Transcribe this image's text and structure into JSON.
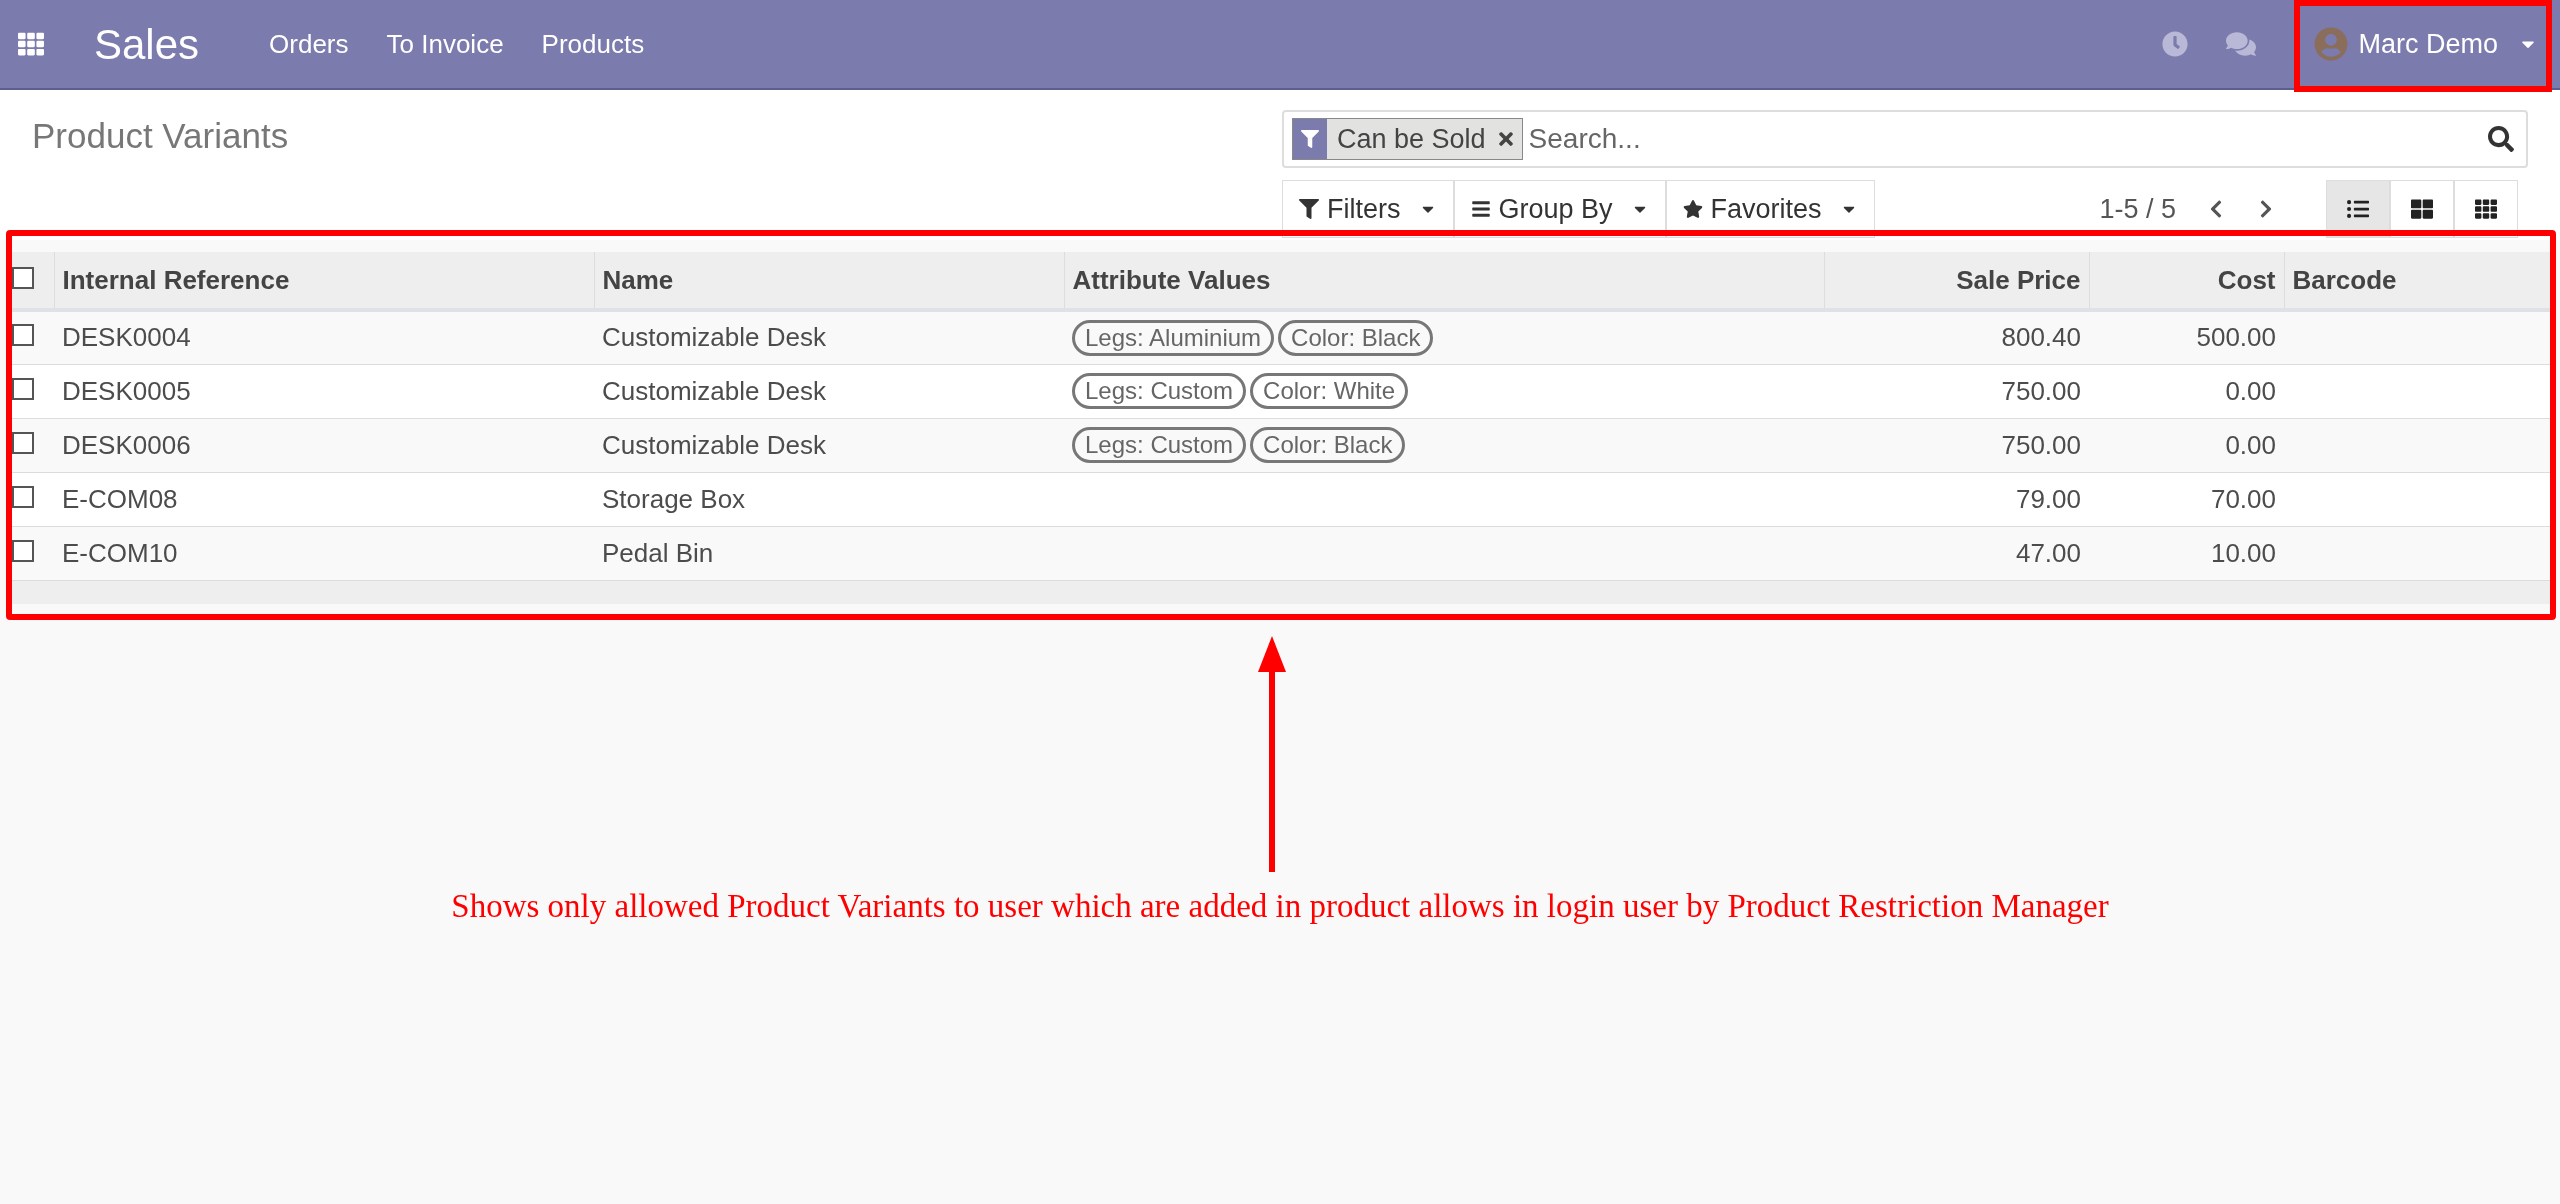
{
  "navbar": {
    "app_name": "Sales",
    "menus": [
      "Orders",
      "To Invoice",
      "Products"
    ],
    "user_name": "Marc Demo"
  },
  "control_panel": {
    "title": "Product Variants",
    "search": {
      "facet": "Can be Sold",
      "placeholder": "Search..."
    },
    "buttons": [
      {
        "kind": "filter",
        "label": "Filters"
      },
      {
        "kind": "group",
        "label": "Group By"
      },
      {
        "kind": "favorite",
        "label": "Favorites"
      }
    ],
    "pager": "1-5 / 5",
    "views": [
      {
        "kind": "list",
        "selected": true
      },
      {
        "kind": "kanban",
        "selected": false
      },
      {
        "kind": "grid",
        "selected": false
      }
    ]
  },
  "table": {
    "select_all_checked": false,
    "columns": [
      {
        "label": "Internal Reference",
        "kind": "text"
      },
      {
        "label": "Name",
        "kind": "text"
      },
      {
        "label": "Attribute Values",
        "kind": "text"
      },
      {
        "label": "Sale Price",
        "kind": "number"
      },
      {
        "label": "Cost",
        "kind": "number"
      },
      {
        "label": "Barcode",
        "kind": "text"
      }
    ],
    "rows": [
      {
        "checked": false,
        "reference": "DESK0004",
        "name": "Customizable Desk",
        "attributes": [
          "Legs: Aluminium",
          "Color: Black"
        ],
        "sale_price": "800.40",
        "cost": "500.00"
      },
      {
        "checked": false,
        "reference": "DESK0005",
        "name": "Customizable Desk",
        "attributes": [
          "Legs: Custom",
          "Color: White"
        ],
        "sale_price": "750.00",
        "cost": "0.00"
      },
      {
        "checked": false,
        "reference": "DESK0006",
        "name": "Customizable Desk",
        "attributes": [
          "Legs: Custom",
          "Color: Black"
        ],
        "sale_price": "750.00",
        "cost": "0.00"
      },
      {
        "checked": false,
        "reference": "E-COM08",
        "name": "Storage Box",
        "sale_price": "79.00",
        "cost": "70.00"
      },
      {
        "checked": false,
        "reference": "E-COM10",
        "name": "Pedal Bin",
        "sale_price": "47.00",
        "cost": "10.00"
      }
    ]
  },
  "annotation": {
    "text": "Shows only allowed Product Variants to user which are added in product allows in login user by Product Restriction Manager"
  }
}
